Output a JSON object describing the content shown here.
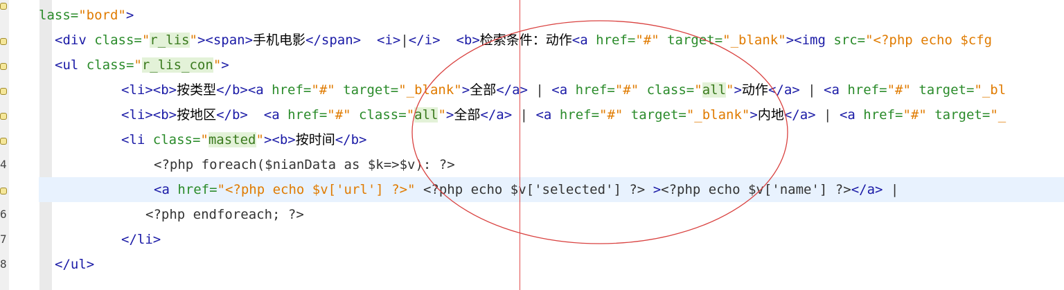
{
  "editor": {
    "lines": [
      {
        "segments": [
          {
            "t": "attr",
            "v": "lass="
          },
          {
            "t": "str",
            "v": "\"bord\""
          },
          {
            "t": "tag",
            "v": ">"
          }
        ]
      },
      {
        "segments": [
          {
            "t": "tag",
            "v": "<div "
          },
          {
            "t": "attr",
            "v": "class="
          },
          {
            "t": "str",
            "v": "\""
          },
          {
            "t": "hl",
            "v": "r_lis"
          },
          {
            "t": "str",
            "v": "\""
          },
          {
            "t": "tag",
            "v": "><span>"
          },
          {
            "t": "cjk",
            "v": "手机电影"
          },
          {
            "t": "tag",
            "v": "</span>"
          },
          {
            "t": "plain",
            "v": "  "
          },
          {
            "t": "tag",
            "v": "<i>"
          },
          {
            "t": "plain",
            "v": "|"
          },
          {
            "t": "tag",
            "v": "</i>"
          },
          {
            "t": "plain",
            "v": "  "
          },
          {
            "t": "tag",
            "v": "<b>"
          },
          {
            "t": "cjk",
            "v": "检索条件：动作"
          },
          {
            "t": "tag",
            "v": "<a "
          },
          {
            "t": "attr",
            "v": "href="
          },
          {
            "t": "str",
            "v": "\"#\""
          },
          {
            "t": "attr",
            "v": " target="
          },
          {
            "t": "str",
            "v": "\"_blank\""
          },
          {
            "t": "tag",
            "v": "><img "
          },
          {
            "t": "attr",
            "v": "src="
          },
          {
            "t": "str",
            "v": "\"<?php echo $cfg"
          }
        ]
      },
      {
        "segments": [
          {
            "t": "tag",
            "v": "<ul "
          },
          {
            "t": "attr",
            "v": "class="
          },
          {
            "t": "str",
            "v": "\""
          },
          {
            "t": "hl",
            "v": "r_lis_con"
          },
          {
            "t": "str",
            "v": "\""
          },
          {
            "t": "tag",
            "v": ">"
          }
        ]
      },
      {
        "segments": [
          {
            "t": "tag",
            "v": "<li><b>"
          },
          {
            "t": "cjk",
            "v": "按类型"
          },
          {
            "t": "tag",
            "v": "</b><a "
          },
          {
            "t": "attr",
            "v": "href="
          },
          {
            "t": "str",
            "v": "\"#\""
          },
          {
            "t": "attr",
            "v": " target="
          },
          {
            "t": "str",
            "v": "\"_blank\""
          },
          {
            "t": "tag",
            "v": ">"
          },
          {
            "t": "cjk",
            "v": "全部"
          },
          {
            "t": "tag",
            "v": "</a>"
          },
          {
            "t": "plain",
            "v": " | "
          },
          {
            "t": "tag",
            "v": "<a "
          },
          {
            "t": "attr",
            "v": "href="
          },
          {
            "t": "str",
            "v": "\"#\""
          },
          {
            "t": "attr",
            "v": " class="
          },
          {
            "t": "str",
            "v": "\""
          },
          {
            "t": "hl",
            "v": "all"
          },
          {
            "t": "str",
            "v": "\""
          },
          {
            "t": "tag",
            "v": ">"
          },
          {
            "t": "cjk",
            "v": "动作"
          },
          {
            "t": "tag",
            "v": "</a>"
          },
          {
            "t": "plain",
            "v": " | "
          },
          {
            "t": "tag",
            "v": "<a "
          },
          {
            "t": "attr",
            "v": "href="
          },
          {
            "t": "str",
            "v": "\"#\""
          },
          {
            "t": "attr",
            "v": " target="
          },
          {
            "t": "str",
            "v": "\"_bl"
          }
        ]
      },
      {
        "segments": [
          {
            "t": "tag",
            "v": "<li><b>"
          },
          {
            "t": "cjk",
            "v": "按地区"
          },
          {
            "t": "tag",
            "v": "</b>"
          },
          {
            "t": "plain",
            "v": "  "
          },
          {
            "t": "tag",
            "v": "<a "
          },
          {
            "t": "attr",
            "v": "href="
          },
          {
            "t": "str",
            "v": "\"#\""
          },
          {
            "t": "attr",
            "v": " class="
          },
          {
            "t": "str",
            "v": "\""
          },
          {
            "t": "hl",
            "v": "all"
          },
          {
            "t": "str",
            "v": "\""
          },
          {
            "t": "tag",
            "v": ">"
          },
          {
            "t": "cjk",
            "v": "全部"
          },
          {
            "t": "tag",
            "v": "</a>"
          },
          {
            "t": "plain",
            "v": " | "
          },
          {
            "t": "tag",
            "v": "<a "
          },
          {
            "t": "attr",
            "v": "href="
          },
          {
            "t": "str",
            "v": "\"#\""
          },
          {
            "t": "attr",
            "v": " target="
          },
          {
            "t": "str",
            "v": "\"_blank\""
          },
          {
            "t": "tag",
            "v": ">"
          },
          {
            "t": "cjk",
            "v": "内地"
          },
          {
            "t": "tag",
            "v": "</a>"
          },
          {
            "t": "plain",
            "v": " | "
          },
          {
            "t": "tag",
            "v": "<a "
          },
          {
            "t": "attr",
            "v": "href="
          },
          {
            "t": "str",
            "v": "\"#\""
          },
          {
            "t": "attr",
            "v": " target="
          },
          {
            "t": "str",
            "v": "\"_"
          }
        ]
      },
      {
        "segments": [
          {
            "t": "tag",
            "v": "<li "
          },
          {
            "t": "attr",
            "v": "class="
          },
          {
            "t": "str",
            "v": "\""
          },
          {
            "t": "hl",
            "v": "masted"
          },
          {
            "t": "str",
            "v": "\""
          },
          {
            "t": "tag",
            "v": "><b>"
          },
          {
            "t": "cjk",
            "v": "按时间"
          },
          {
            "t": "tag",
            "v": "</b>"
          }
        ]
      },
      {
        "segments": [
          {
            "t": "php",
            "v": "<?php foreach($nianData as $k=>$v): ?>"
          }
        ]
      },
      {
        "segments": [
          {
            "t": "tag",
            "v": "<a "
          },
          {
            "t": "attr",
            "v": "href="
          },
          {
            "t": "str",
            "v": "\"<?php echo $v['url'] ?>\""
          },
          {
            "t": "php",
            "v": " <?php echo $v['selected'] ?> "
          },
          {
            "t": "tag",
            "v": ">"
          },
          {
            "t": "php",
            "v": "<?php echo $v['name'] ?>"
          },
          {
            "t": "tag",
            "v": "</a>"
          },
          {
            "t": "plain",
            "v": " |"
          }
        ]
      },
      {
        "segments": [
          {
            "t": "php",
            "v": "<?php endforeach; ?>"
          }
        ]
      },
      {
        "segments": [
          {
            "t": "tag",
            "v": "</li>"
          }
        ]
      },
      {
        "segments": [
          {
            "t": "tag",
            "v": "</ul>"
          }
        ]
      }
    ],
    "gutter_numbers": [
      "4",
      "6",
      "7",
      "8"
    ],
    "colors": {
      "tag": "#1a1aa6",
      "attr": "#2a8b2a",
      "string": "#e07b00",
      "highlight": "#e3f2d8",
      "current_line": "#e8f2fe",
      "margin_line": "#e24a4a",
      "annotation_circle": "#d9413f"
    }
  }
}
